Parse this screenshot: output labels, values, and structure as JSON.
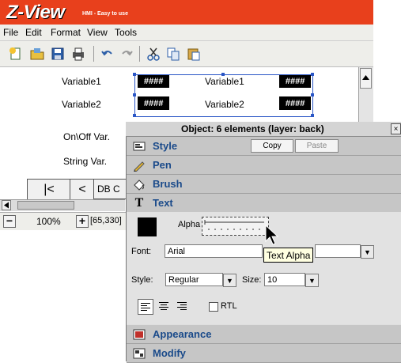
{
  "app": {
    "logo": "Z-View",
    "tagline": "HMI - Easy to use"
  },
  "menu": [
    "File",
    "Edit",
    "Format",
    "View",
    "Tools"
  ],
  "canvas": {
    "rows": [
      {
        "label": "Variable1",
        "value": "####",
        "label2": "Variable1",
        "value2": "####"
      },
      {
        "label": "Variable2",
        "value": "####",
        "label2": "Variable2",
        "value2": "####"
      }
    ],
    "onoff_label": "On\\Off Var.",
    "string_label": "String Var."
  },
  "nav": {
    "first": "|<",
    "prev": "<",
    "db": "DB C"
  },
  "status": {
    "zoom": "100%",
    "coords": "[65,330]",
    "minus": "−",
    "plus": "+"
  },
  "panel": {
    "title": "Object: 6 elements (layer: back)",
    "close": "×",
    "sections": {
      "style": "Style",
      "pen": "Pen",
      "brush": "Brush",
      "text": "Text",
      "appearance": "Appearance",
      "modify": "Modify"
    },
    "copy_label": "Copy",
    "paste_label": "Paste",
    "alpha_label": "Alpha",
    "tooltip": "Text Alpha",
    "font_label": "Font:",
    "font_value": "Arial",
    "style_label": "Style:",
    "style_value": "Regular",
    "size_label": "Size:",
    "size_value": "10",
    "rtl_label": "RTL",
    "text_color": "#000000"
  }
}
